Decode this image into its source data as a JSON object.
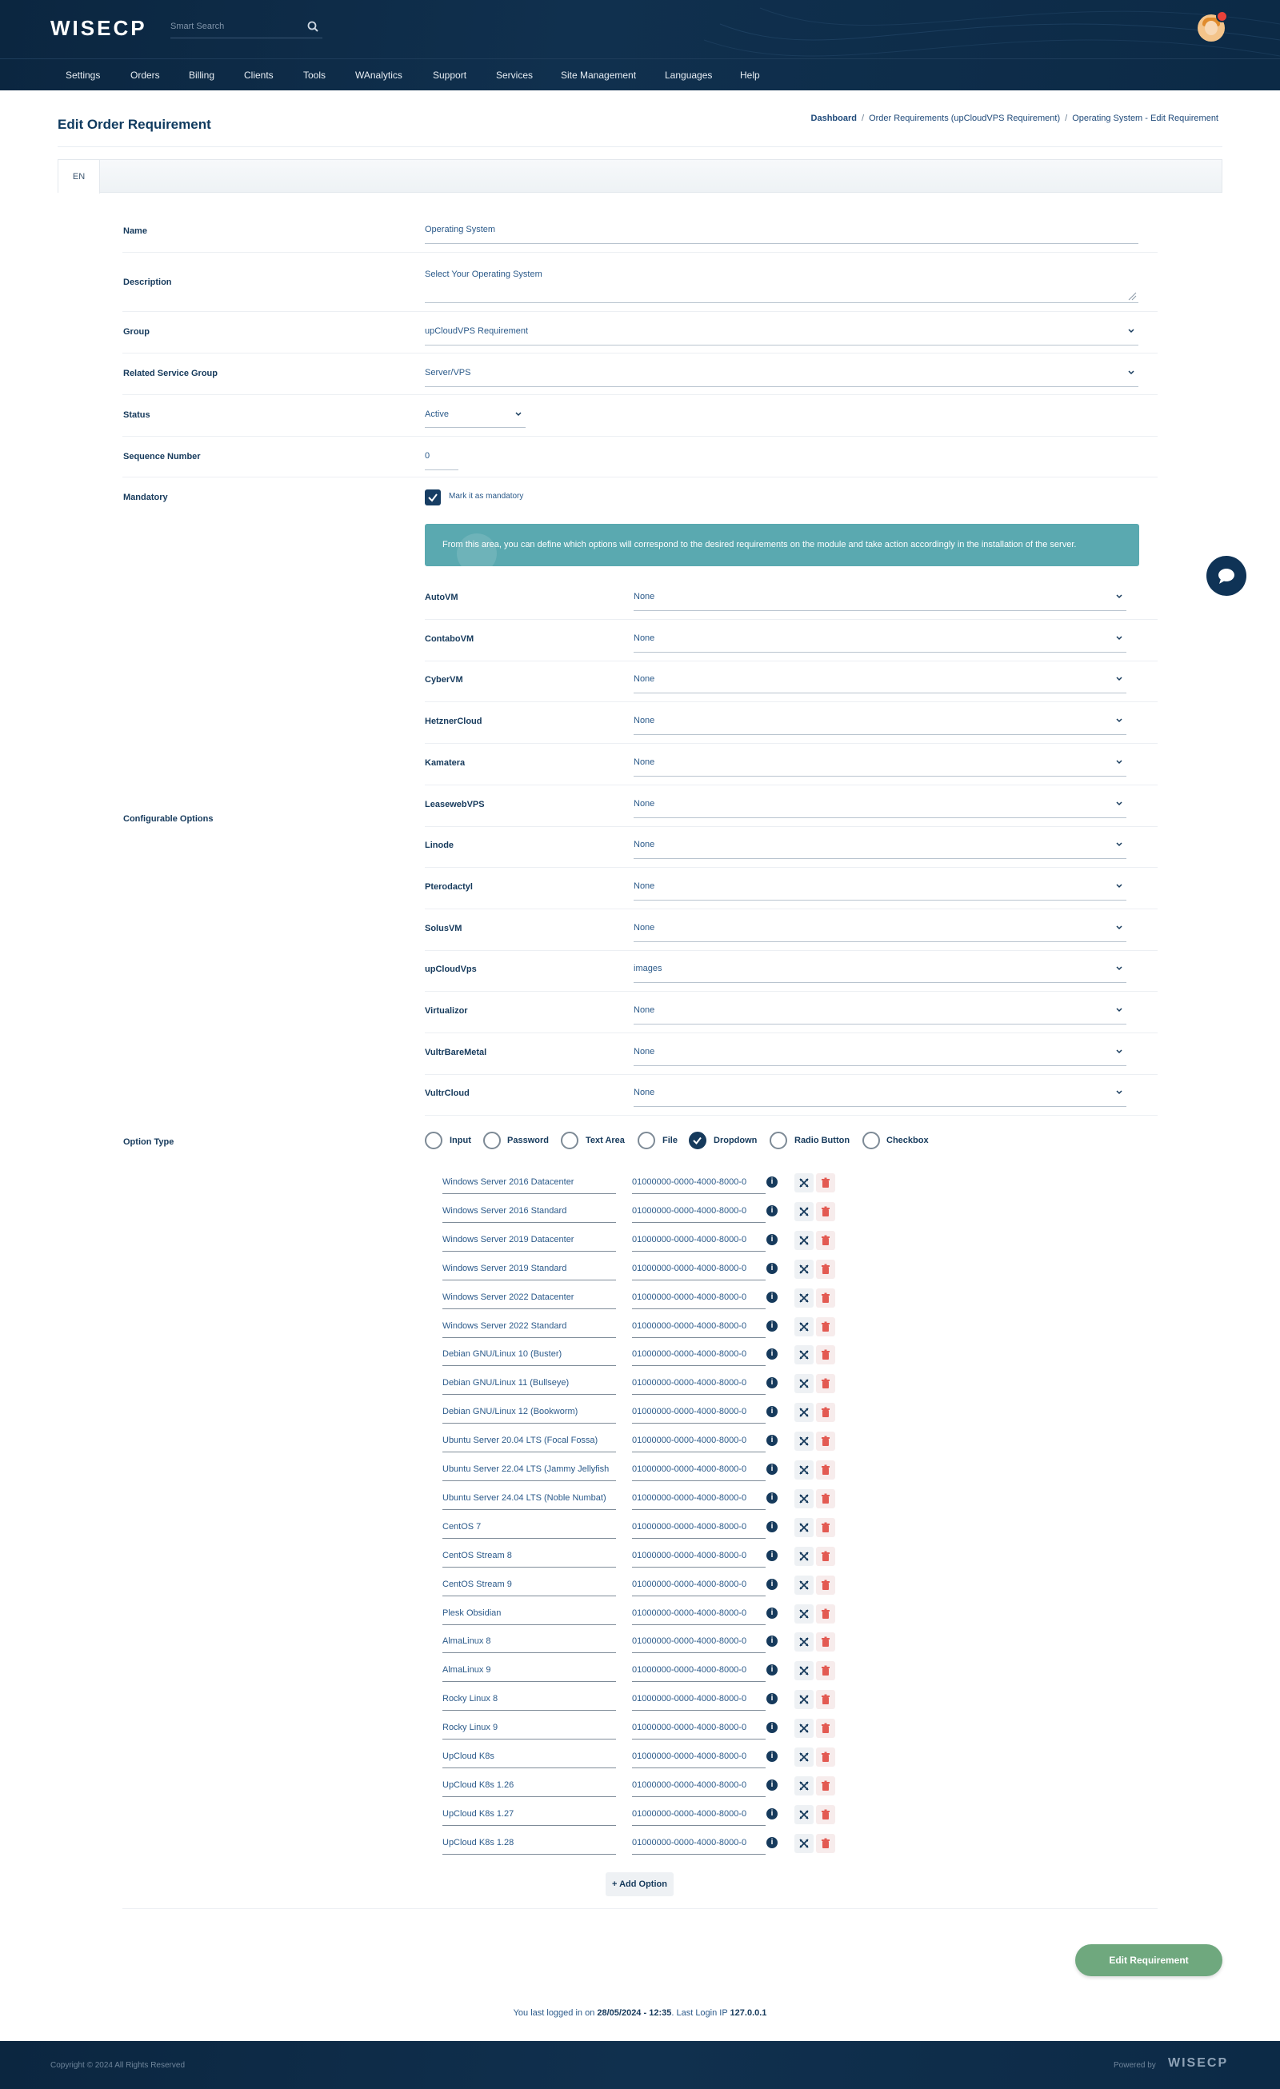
{
  "header": {
    "logo": "WISECP",
    "search_placeholder": "Smart Search",
    "nav": [
      "Settings",
      "Orders",
      "Billing",
      "Clients",
      "Tools",
      "WAnalytics",
      "Support",
      "Services",
      "Site Management",
      "Languages",
      "Help"
    ]
  },
  "page": {
    "title": "Edit Order Requirement",
    "breadcrumb": [
      "Dashboard",
      "Order Requirements (upCloudVPS Requirement)",
      "Operating System - Edit Requirement"
    ],
    "language_tab": "EN"
  },
  "form": {
    "name": {
      "label": "Name",
      "value": "Operating System"
    },
    "description": {
      "label": "Description",
      "value": "Select Your Operating System"
    },
    "group": {
      "label": "Group",
      "value": "upCloudVPS Requirement"
    },
    "related_service_group": {
      "label": "Related Service Group",
      "value": "Server/VPS"
    },
    "status": {
      "label": "Status",
      "value": "Active"
    },
    "sequence_number": {
      "label": "Sequence Number",
      "value": "0"
    },
    "mandatory": {
      "label": "Mandatory",
      "checkbox_label": "Mark it as mandatory",
      "checked": true
    },
    "configurable_options": {
      "label": "Configurable Options",
      "info": "From this area, you can define which options will correspond to the desired requirements on the module and take action accordingly in the installation of the server.",
      "modules": [
        {
          "name": "AutoVM",
          "value": "None"
        },
        {
          "name": "ContaboVM",
          "value": "None"
        },
        {
          "name": "CyberVM",
          "value": "None"
        },
        {
          "name": "HetznerCloud",
          "value": "None"
        },
        {
          "name": "Kamatera",
          "value": "None"
        },
        {
          "name": "LeasewebVPS",
          "value": "None"
        },
        {
          "name": "Linode",
          "value": "None"
        },
        {
          "name": "Pterodactyl",
          "value": "None"
        },
        {
          "name": "SolusVM",
          "value": "None"
        },
        {
          "name": "upCloudVps",
          "value": "images"
        },
        {
          "name": "Virtualizor",
          "value": "None"
        },
        {
          "name": "VultrBareMetal",
          "value": "None"
        },
        {
          "name": "VultrCloud",
          "value": "None"
        }
      ]
    },
    "option_type": {
      "label": "Option Type",
      "types": [
        "Input",
        "Password",
        "Text Area",
        "File",
        "Dropdown",
        "Radio Button",
        "Checkbox"
      ],
      "selected": "Dropdown"
    },
    "options": [
      {
        "name": "Windows Server 2016 Datacenter",
        "value": "01000000-0000-4000-8000-0"
      },
      {
        "name": "Windows Server 2016 Standard",
        "value": "01000000-0000-4000-8000-0"
      },
      {
        "name": "Windows Server 2019 Datacenter",
        "value": "01000000-0000-4000-8000-0"
      },
      {
        "name": "Windows Server 2019 Standard",
        "value": "01000000-0000-4000-8000-0"
      },
      {
        "name": "Windows Server 2022 Datacenter",
        "value": "01000000-0000-4000-8000-0"
      },
      {
        "name": "Windows Server 2022 Standard",
        "value": "01000000-0000-4000-8000-0"
      },
      {
        "name": "Debian GNU/Linux 10 (Buster)",
        "value": "01000000-0000-4000-8000-0"
      },
      {
        "name": "Debian GNU/Linux 11 (Bullseye)",
        "value": "01000000-0000-4000-8000-0"
      },
      {
        "name": "Debian GNU/Linux 12 (Bookworm)",
        "value": "01000000-0000-4000-8000-0"
      },
      {
        "name": "Ubuntu Server 20.04 LTS (Focal Fossa)",
        "value": "01000000-0000-4000-8000-0"
      },
      {
        "name": "Ubuntu Server 22.04 LTS (Jammy Jellyfish",
        "value": "01000000-0000-4000-8000-0"
      },
      {
        "name": "Ubuntu Server 24.04 LTS (Noble Numbat)",
        "value": "01000000-0000-4000-8000-0"
      },
      {
        "name": "CentOS 7",
        "value": "01000000-0000-4000-8000-0"
      },
      {
        "name": "CentOS Stream 8",
        "value": "01000000-0000-4000-8000-0"
      },
      {
        "name": "CentOS Stream 9",
        "value": "01000000-0000-4000-8000-0"
      },
      {
        "name": "Plesk Obsidian",
        "value": "01000000-0000-4000-8000-0"
      },
      {
        "name": "AlmaLinux 8",
        "value": "01000000-0000-4000-8000-0"
      },
      {
        "name": "AlmaLinux 9",
        "value": "01000000-0000-4000-8000-0"
      },
      {
        "name": "Rocky Linux 8",
        "value": "01000000-0000-4000-8000-0"
      },
      {
        "name": "Rocky Linux 9",
        "value": "01000000-0000-4000-8000-0"
      },
      {
        "name": "UpCloud K8s",
        "value": "01000000-0000-4000-8000-0"
      },
      {
        "name": "UpCloud K8s 1.26",
        "value": "01000000-0000-4000-8000-0"
      },
      {
        "name": "UpCloud K8s 1.27",
        "value": "01000000-0000-4000-8000-0"
      },
      {
        "name": "UpCloud K8s 1.28",
        "value": "01000000-0000-4000-8000-0"
      }
    ],
    "add_option_label": "+ Add Option",
    "submit_label": "Edit Requirement"
  },
  "last_login": {
    "prefix": "You last logged in on",
    "datetime": "28/05/2024 - 12:35",
    "ip_label": "Last Login IP",
    "ip": "127.0.0.1"
  },
  "footer": {
    "copyright": "Copyright © 2024 All Rights Reserved",
    "powered_by": "Powered by",
    "logo": "WISECP"
  },
  "colors": {
    "header_bg": "#0d2b47",
    "accent": "#163a5c",
    "banner": "#5aa9b0",
    "submit": "#6fa87e",
    "delete": "#e35a52"
  }
}
